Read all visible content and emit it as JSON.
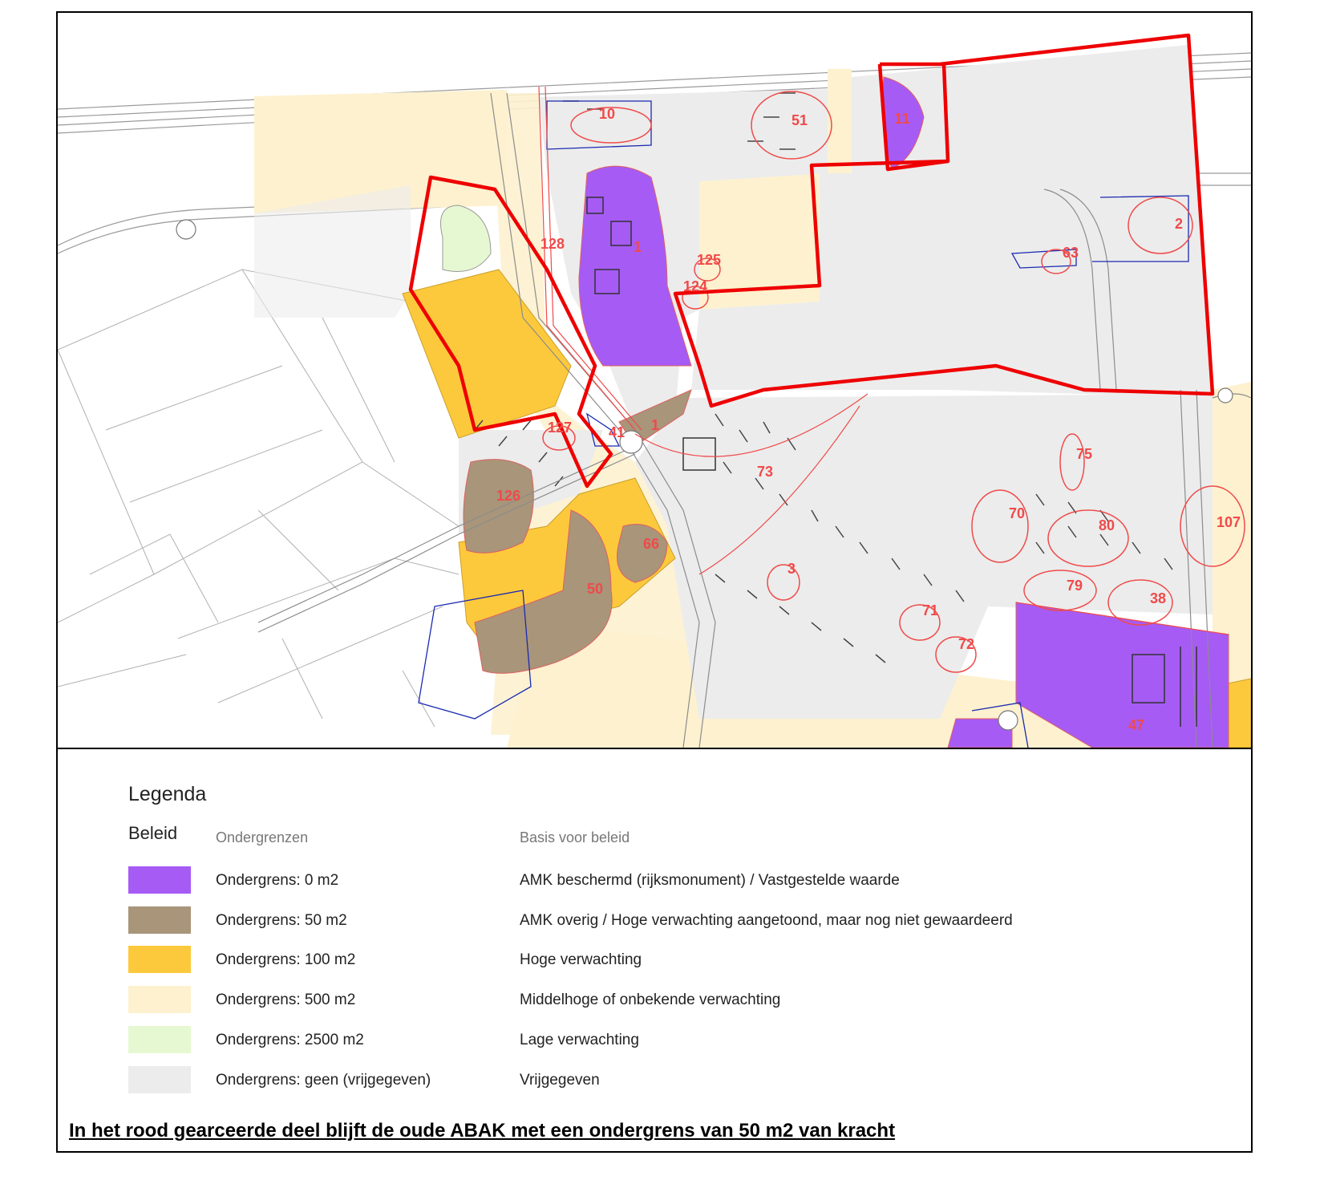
{
  "colors": {
    "purple": "#a65bf5",
    "brown": "#a8957a",
    "orange": "#fdc93c",
    "lightyellow": "#fdf1cf",
    "lightgreen": "#e6f8d2",
    "grey": "#ececec",
    "red_outline": "#ee0000",
    "blue_outline": "#1a2ab0"
  },
  "map": {
    "zone_labels": [
      "10",
      "51",
      "11",
      "2",
      "63",
      "1",
      "125",
      "124",
      "128",
      "127",
      "41",
      "126",
      "66",
      "50",
      "73",
      "3",
      "75",
      "70",
      "80",
      "107",
      "79",
      "38",
      "71",
      "72",
      "47",
      "1"
    ]
  },
  "legend": {
    "title": "Legenda",
    "section": "Beleid",
    "col_header_limit": "Ondergrenzen",
    "col_header_basis": "Basis voor beleid",
    "rows": [
      {
        "label": "Ondergrens: 0 m2",
        "basis": "AMK beschermd (rijksmonument) / Vastgestelde waarde",
        "color": "#a65bf5"
      },
      {
        "label": "Ondergrens: 50 m2",
        "basis": "AMK overig / Hoge verwachting aangetoond, maar nog niet gewaardeerd",
        "color": "#a8957a"
      },
      {
        "label": "Ondergrens: 100 m2",
        "basis": "Hoge verwachting",
        "color": "#fdc93c"
      },
      {
        "label": "Ondergrens: 500 m2",
        "basis": "Middelhoge of onbekende verwachting",
        "color": "#fdf1cf"
      },
      {
        "label": "Ondergrens: 2500 m2",
        "basis": "Lage verwachting",
        "color": "#e6f8d2"
      },
      {
        "label": "Ondergrens: geen (vrijgegeven)",
        "basis": "Vrijgegeven",
        "color": "#ececec"
      }
    ]
  },
  "note": "In het rood gearceerde deel blijft de oude ABAK met een ondergrens van 50 m2 van kracht"
}
